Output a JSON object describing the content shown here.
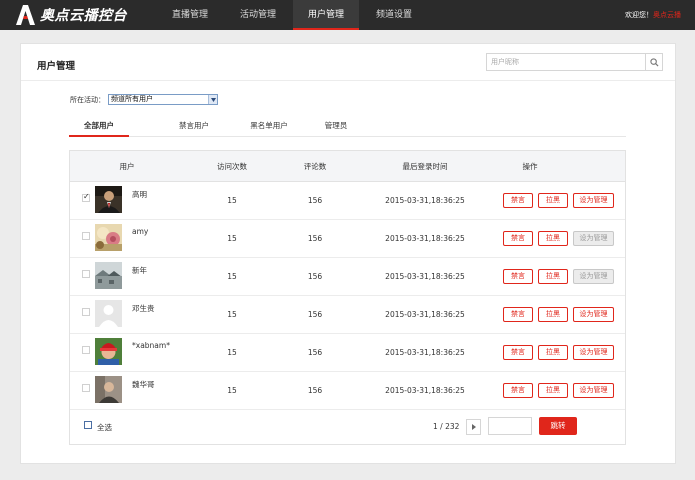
{
  "app": {
    "name": "奥点云播控台",
    "welcome": "欢迎您！",
    "username": "奥点云播",
    "brand_color": "#e0261b"
  },
  "nav": {
    "items": [
      {
        "label": "直播管理",
        "active": false
      },
      {
        "label": "活动管理",
        "active": false
      },
      {
        "label": "用户管理",
        "active": true
      },
      {
        "label": "频道设置",
        "active": false
      }
    ]
  },
  "page": {
    "title": "用户管理",
    "search_placeholder": "用户昵称"
  },
  "filter": {
    "label": "所在活动：",
    "selected": "频道所有用户"
  },
  "tabs": [
    {
      "label": "全部用户",
      "active": true
    },
    {
      "label": "禁言用户",
      "active": false
    },
    {
      "label": "黑名单用户",
      "active": false
    },
    {
      "label": "管理员",
      "active": false
    }
  ],
  "table": {
    "headers": [
      "用户",
      "访问次数",
      "评论数",
      "最后登录时间",
      "操作"
    ],
    "actions": {
      "mute": "禁言",
      "block": "拉黑",
      "set_admin": "设为管理"
    },
    "rows": [
      {
        "name": "高明",
        "visits": "15",
        "comments": "156",
        "last_login": "2015-03-31,18:36:25",
        "checked": true,
        "admin_disabled": false,
        "avatar": "man-in-suit"
      },
      {
        "name": "amy",
        "visits": "15",
        "comments": "156",
        "last_login": "2015-03-31,18:36:25",
        "checked": false,
        "admin_disabled": true,
        "avatar": "flowers"
      },
      {
        "name": "新年",
        "visits": "15",
        "comments": "156",
        "last_login": "2015-03-31,18:36:25",
        "checked": false,
        "admin_disabled": true,
        "avatar": "rooftops"
      },
      {
        "name": "邓生贵",
        "visits": "15",
        "comments": "156",
        "last_login": "2015-03-31,18:36:25",
        "checked": false,
        "admin_disabled": false,
        "avatar": "default-user"
      },
      {
        "name": "*xabnam*",
        "visits": "15",
        "comments": "156",
        "last_login": "2015-03-31,18:36:25",
        "checked": false,
        "admin_disabled": false,
        "avatar": "red-hat-child"
      },
      {
        "name": "魏华哥",
        "visits": "15",
        "comments": "156",
        "last_login": "2015-03-31,18:36:25",
        "checked": false,
        "admin_disabled": false,
        "avatar": "person-portrait"
      }
    ]
  },
  "footer": {
    "select_all": "全选",
    "pager": "1 / 232",
    "jump": "跳转"
  }
}
